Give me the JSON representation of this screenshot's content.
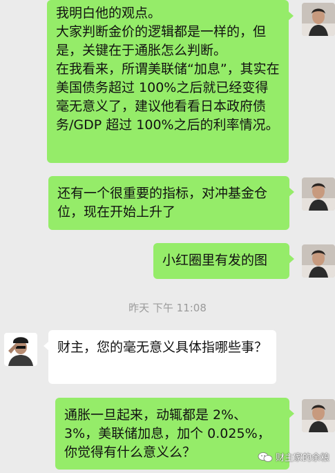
{
  "messages": [
    {
      "side": "right",
      "text": "我明白他的观点。\n大家判断金价的逻辑都是一样的，但是，关键在于通胀怎么判断。\n在我看来，所谓美联储“加息”，其实在美国债务超过 100%之后就已经变得毫无意义了，建议他看看日本政府债务/GDP 超过 100%之后的利率情况。"
    },
    {
      "side": "right",
      "text": "还有一个很重要的指标，对冲基金仓位，现在开始上升了"
    },
    {
      "side": "right",
      "text": "小红圈里有发的图"
    },
    {
      "side": "left",
      "text": "财主，您的毫无意义具体指哪些事？"
    },
    {
      "side": "right",
      "text": "通胀一旦起来，动辄都是 2%、3%，美联储加息，加个 0.025%，你觉得有什么意义么？"
    }
  ],
  "timestamp": "昨天 下午 11:08",
  "watermark": {
    "text": "财主家的余粮",
    "icon": "wechat-official-account-icon"
  },
  "colors": {
    "background": "#ebebeb",
    "bubble_self": "#95ec69",
    "bubble_other": "#ffffff",
    "timestamp": "#9a9a9a"
  },
  "avatars": {
    "self": "avatar-man-portrait",
    "other": "avatar-saluting-man"
  }
}
